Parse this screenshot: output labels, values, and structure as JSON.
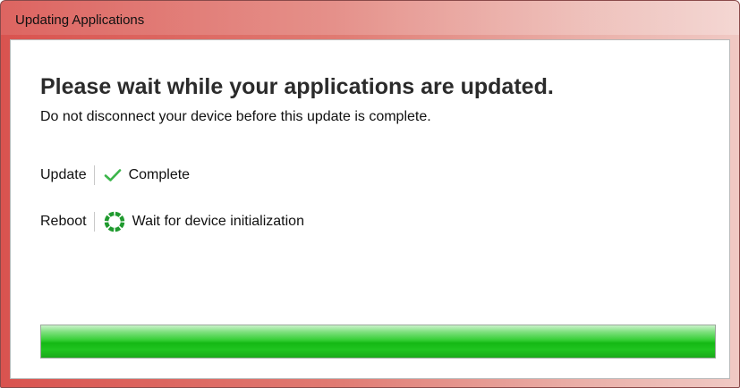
{
  "window": {
    "title": "Updating Applications"
  },
  "main": {
    "heading": "Please wait while your applications are updated.",
    "subtext": "Do not disconnect your device before this update is complete.",
    "steps": [
      {
        "label": "Update",
        "status": "Complete",
        "icon": "checkmark-icon",
        "status_color": "#3bb54a"
      },
      {
        "label": "Reboot",
        "status": "Wait for device initialization",
        "icon": "spinner-icon",
        "status_color": "#1f9a2e"
      }
    ]
  },
  "progress": {
    "fraction": 1.0,
    "color": "#22c322"
  },
  "colors": {
    "titlebar_accent": "#d9534f"
  }
}
